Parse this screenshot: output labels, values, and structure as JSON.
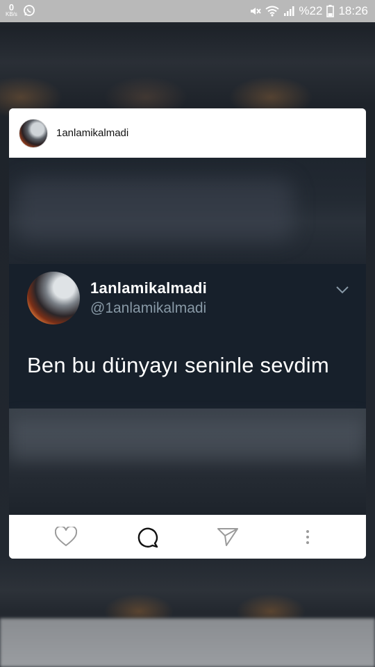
{
  "status_bar": {
    "net_speed_value": "0",
    "net_speed_unit": "KB/s",
    "battery": "%22",
    "time": "18:26",
    "icons": [
      "whatsapp-icon",
      "mute-icon",
      "wifi-icon",
      "signal-icon",
      "battery-icon"
    ]
  },
  "card": {
    "header": {
      "username": "1anlamikalmadi"
    },
    "tweet": {
      "name": "1anlamikalmadi",
      "handle": "@1anlamikalmadi",
      "text": "Ben bu dünyayı seninle sevdim"
    },
    "actions": [
      "heart-icon",
      "comment-icon",
      "send-icon",
      "more-icon"
    ]
  },
  "colors": {
    "tweet_bg": "#17202b",
    "handle": "#8899a6",
    "card_bg": "#ffffff"
  }
}
